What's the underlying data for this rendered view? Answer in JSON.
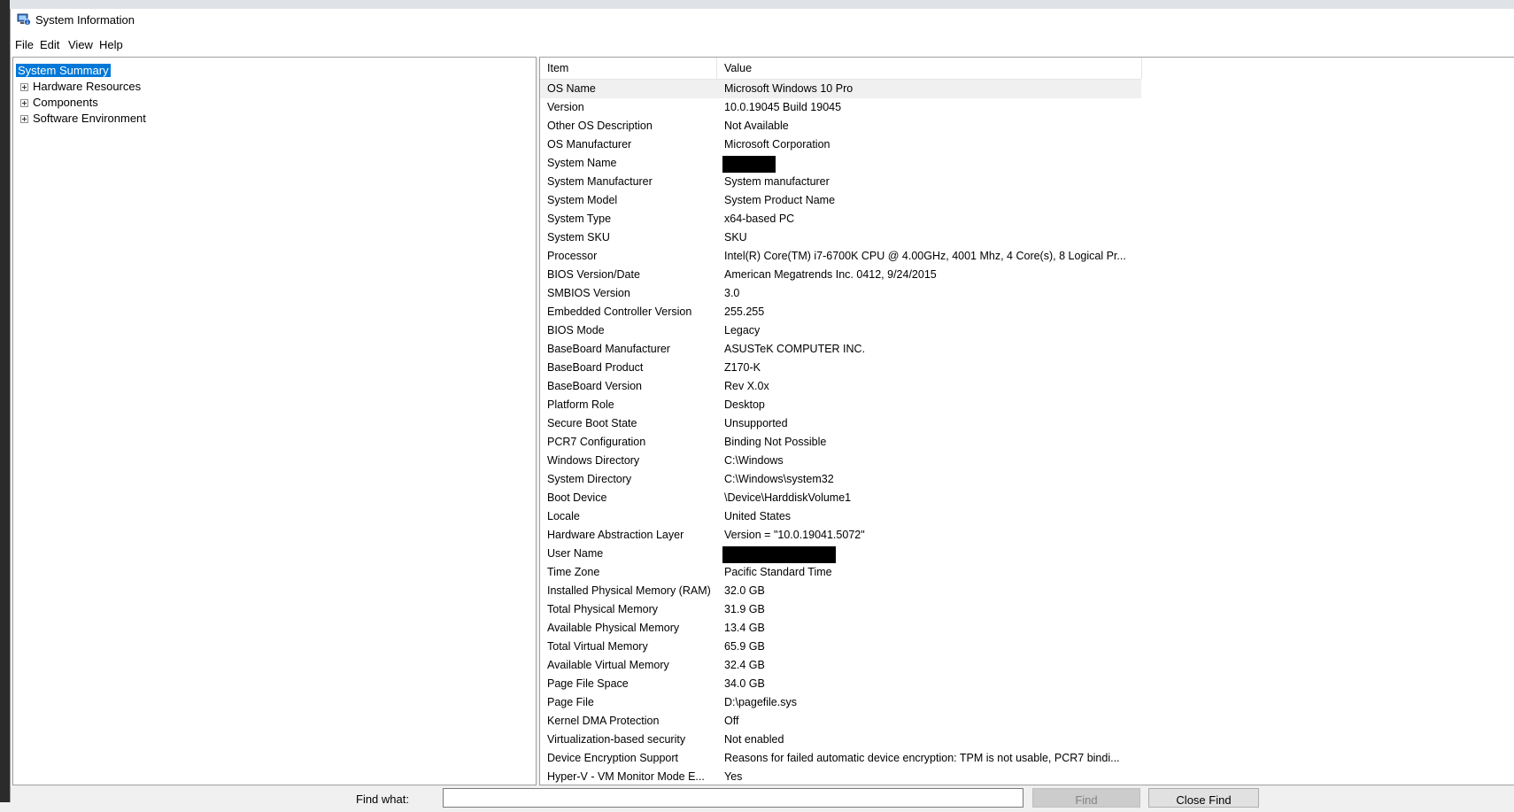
{
  "window": {
    "title": "System Information"
  },
  "menu": [
    "File",
    "Edit",
    "View",
    "Help"
  ],
  "tree": [
    {
      "label": "System Summary",
      "selected": true,
      "expandable": false
    },
    {
      "label": "Hardware Resources",
      "selected": false,
      "expandable": true
    },
    {
      "label": "Components",
      "selected": false,
      "expandable": true
    },
    {
      "label": "Software Environment",
      "selected": false,
      "expandable": true
    }
  ],
  "table": {
    "columns": [
      "Item",
      "Value"
    ],
    "rows": [
      {
        "item": "OS Name",
        "value": "Microsoft Windows 10 Pro"
      },
      {
        "item": "Version",
        "value": "10.0.19045 Build 19045"
      },
      {
        "item": "Other OS Description",
        "value": "Not Available"
      },
      {
        "item": "OS Manufacturer",
        "value": "Microsoft Corporation"
      },
      {
        "item": "System Name",
        "value": "",
        "redacted": "short"
      },
      {
        "item": "System Manufacturer",
        "value": "System manufacturer"
      },
      {
        "item": "System Model",
        "value": "System Product Name"
      },
      {
        "item": "System Type",
        "value": "x64-based PC"
      },
      {
        "item": "System SKU",
        "value": "SKU"
      },
      {
        "item": "Processor",
        "value": "Intel(R) Core(TM) i7-6700K CPU @ 4.00GHz, 4001 Mhz, 4 Core(s), 8 Logical Pr..."
      },
      {
        "item": "BIOS Version/Date",
        "value": "American Megatrends Inc. 0412, 9/24/2015"
      },
      {
        "item": "SMBIOS Version",
        "value": "3.0"
      },
      {
        "item": "Embedded Controller Version",
        "value": "255.255"
      },
      {
        "item": "BIOS Mode",
        "value": "Legacy"
      },
      {
        "item": "BaseBoard Manufacturer",
        "value": "ASUSTeK COMPUTER INC."
      },
      {
        "item": "BaseBoard Product",
        "value": "Z170-K"
      },
      {
        "item": "BaseBoard Version",
        "value": "Rev X.0x"
      },
      {
        "item": "Platform Role",
        "value": "Desktop"
      },
      {
        "item": "Secure Boot State",
        "value": "Unsupported"
      },
      {
        "item": "PCR7 Configuration",
        "value": "Binding Not Possible"
      },
      {
        "item": "Windows Directory",
        "value": "C:\\Windows"
      },
      {
        "item": "System Directory",
        "value": "C:\\Windows\\system32"
      },
      {
        "item": "Boot Device",
        "value": "\\Device\\HarddiskVolume1"
      },
      {
        "item": "Locale",
        "value": "United States"
      },
      {
        "item": "Hardware Abstraction Layer",
        "value": "Version = \"10.0.19041.5072\""
      },
      {
        "item": "User Name",
        "value": "",
        "redacted": "long"
      },
      {
        "item": "Time Zone",
        "value": "Pacific Standard Time"
      },
      {
        "item": "Installed Physical Memory (RAM)",
        "value": "32.0 GB"
      },
      {
        "item": "Total Physical Memory",
        "value": "31.9 GB"
      },
      {
        "item": "Available Physical Memory",
        "value": "13.4 GB"
      },
      {
        "item": "Total Virtual Memory",
        "value": "65.9 GB"
      },
      {
        "item": "Available Virtual Memory",
        "value": "32.4 GB"
      },
      {
        "item": "Page File Space",
        "value": "34.0 GB"
      },
      {
        "item": "Page File",
        "value": "D:\\pagefile.sys"
      },
      {
        "item": "Kernel DMA Protection",
        "value": "Off"
      },
      {
        "item": "Virtualization-based security",
        "value": "Not enabled"
      },
      {
        "item": "Device Encryption Support",
        "value": "Reasons for failed automatic device encryption: TPM is not usable, PCR7 bindi..."
      },
      {
        "item": "Hyper-V - VM Monitor Mode E...",
        "value": "Yes"
      }
    ]
  },
  "find": {
    "label": "Find what:",
    "value": "",
    "find_button": "Find",
    "close_button": "Close Find"
  },
  "colors": {
    "selection": "#0078d7",
    "pane_border": "#a0a0a0",
    "window_bg": "#f0f0f0"
  }
}
